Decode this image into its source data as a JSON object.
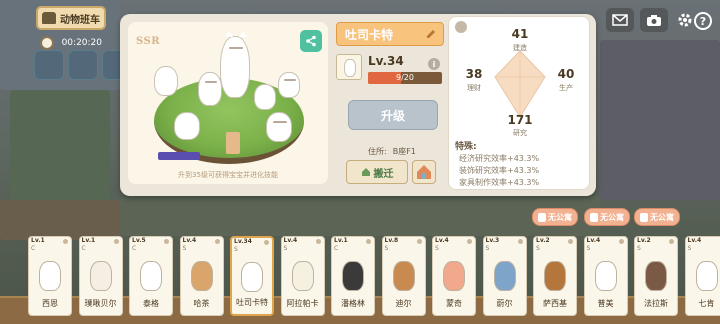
{
  "hud": {
    "train_label": "动物班车",
    "timer": "00:20:20",
    "help_glyph": "?"
  },
  "icons": {
    "mail": "mail-icon",
    "camera": "camera-icon",
    "settings": "gear-icon"
  },
  "character": {
    "rarity": "SSR",
    "name": "吐司卡特",
    "level": "Lv.34",
    "exp_text": "9/20",
    "exp_fraction": 0.45,
    "upgrade_label": "升级",
    "residence_label": "住所:",
    "residence_value": "B座F1",
    "move_label": "搬迁",
    "evolve_tip": "升到35级可获得宝宝并进化技能"
  },
  "stats": {
    "build": {
      "value": "41",
      "label": "建造"
    },
    "finance": {
      "value": "38",
      "label": "理财"
    },
    "produce": {
      "value": "40",
      "label": "生产"
    },
    "research": {
      "value": "171",
      "label": "研究"
    },
    "traits_title": "特殊:",
    "traits": [
      "经济研究效率+43.3%",
      "装饰研究效率+43.3%",
      "家具制作效率+43.3%"
    ]
  },
  "tags": [
    "无公寓",
    "无公寓",
    "无公寓"
  ],
  "cards": [
    {
      "level": "Lv.1",
      "rank": "C",
      "name": "西恩",
      "color": "#ffffff"
    },
    {
      "level": "Lv.1",
      "rank": "C",
      "name": "璞啾贝尔",
      "color": "#f4efe2"
    },
    {
      "level": "Lv.5",
      "rank": "C",
      "name": "泰格",
      "color": "#ffffff"
    },
    {
      "level": "Lv.4",
      "rank": "S",
      "name": "哈茶",
      "color": "#d9a56b"
    },
    {
      "level": "Lv.34",
      "rank": "S",
      "name": "吐司卡特",
      "color": "#ffffff"
    },
    {
      "level": "Lv.4",
      "rank": "S",
      "name": "阿拉帕卡",
      "color": "#f6f0e0"
    },
    {
      "level": "Lv.1",
      "rank": "C",
      "name": "潘格林",
      "color": "#3a3a3a"
    },
    {
      "level": "Lv.8",
      "rank": "S",
      "name": "迪尔",
      "color": "#c98a4f"
    },
    {
      "level": "Lv.4",
      "rank": "S",
      "name": "蒙奇",
      "color": "#f2a88c"
    },
    {
      "level": "Lv.3",
      "rank": "S",
      "name": "蔚尔",
      "color": "#7ea4c9"
    },
    {
      "level": "Lv.2",
      "rank": "S",
      "name": "萨西基",
      "color": "#b5763b"
    },
    {
      "level": "Lv.4",
      "rank": "S",
      "name": "普美",
      "color": "#ffffff"
    },
    {
      "level": "Lv.2",
      "rank": "S",
      "name": "法拉斯",
      "color": "#7a5a44"
    },
    {
      "level": "Lv.4",
      "rank": "S",
      "name": "七肯",
      "color": "#ffffff"
    }
  ]
}
